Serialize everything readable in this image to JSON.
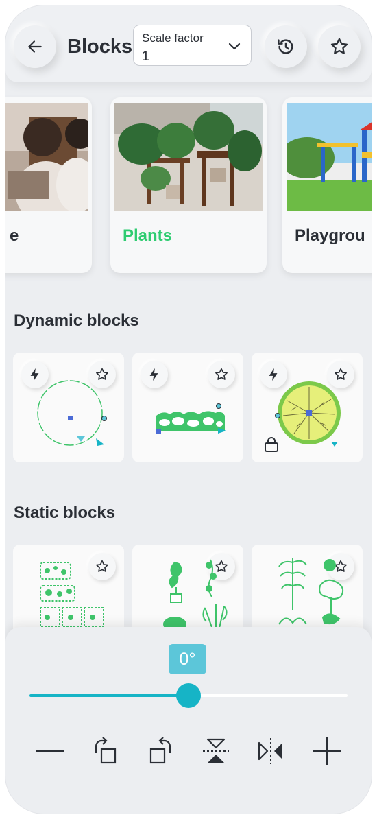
{
  "header": {
    "title": "Blocks",
    "back_icon": "arrow-left-icon",
    "history_icon": "history-icon",
    "favorite_icon": "star-outline-icon",
    "scale": {
      "label": "Scale factor",
      "value": "1"
    }
  },
  "categories": [
    {
      "label": "e",
      "active": false
    },
    {
      "label": "Plants",
      "active": true
    },
    {
      "label": "Playgrou",
      "active": false
    }
  ],
  "dynamic_section": {
    "title": "Dynamic blocks"
  },
  "static_section": {
    "title": "Static blocks"
  },
  "rotation": {
    "label": "0°",
    "value_fraction": 0.5
  },
  "tools": [
    "line-icon",
    "rotate-right-icon",
    "rotate-left-icon",
    "flip-vertical-icon",
    "flip-horizontal-icon",
    "plus-icon"
  ],
  "colors": {
    "accent": "#16b4c6",
    "active_category": "#2ecc71",
    "block_green": "#3fc46a"
  }
}
